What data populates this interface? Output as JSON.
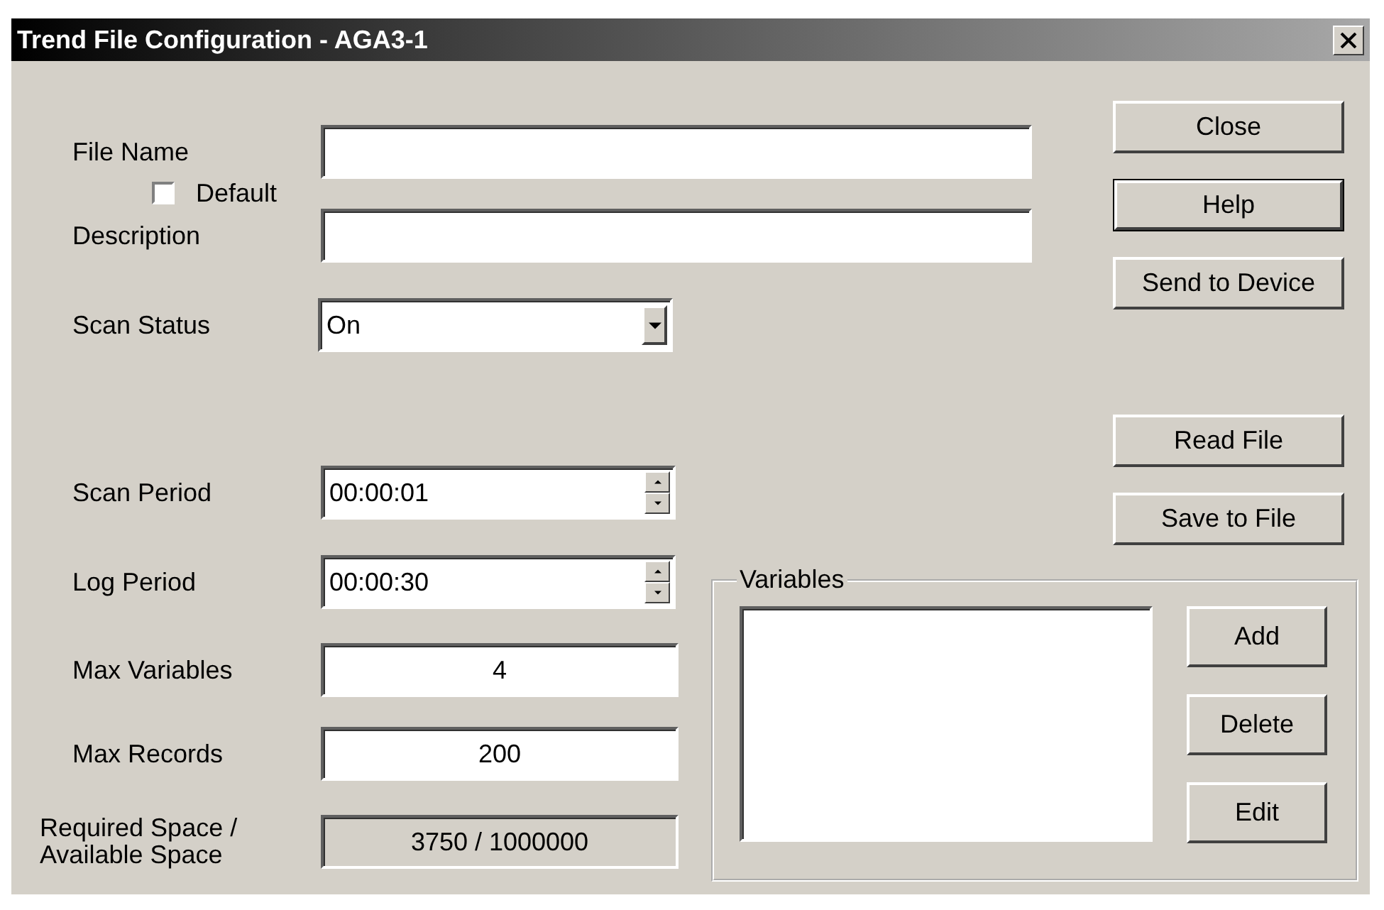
{
  "window": {
    "title": "Trend File Configuration - AGA3-1"
  },
  "fields_upper": [
    {
      "label": "File Name",
      "kind": "text",
      "option": {
        "label": "Default",
        "checked": false
      }
    },
    {
      "label": "Description",
      "kind": "text"
    },
    {
      "label": "Scan Status",
      "kind": "combo",
      "value": "On"
    },
    {
      "label": "Scan Period",
      "kind": "spin",
      "value": "00:00:01"
    }
  ],
  "fields_lower": [
    {
      "label": "Log Period",
      "kind": "spin",
      "value": "00:00:30"
    },
    {
      "label": "Max Variables",
      "kind": "number",
      "value": "4"
    },
    {
      "label": "Max Records",
      "kind": "number",
      "value": "200"
    },
    {
      "label": "Required Space / Available Space",
      "kind": "readout",
      "value": "3750 / 1000000"
    }
  ],
  "buttons_upper": [
    {
      "label": "Close",
      "default": false
    },
    {
      "label": "Help",
      "default": true
    },
    {
      "label": "Send to Device",
      "default": false
    }
  ],
  "buttons_lower": [
    {
      "label": "Read File",
      "default": false
    },
    {
      "label": "Save to File",
      "default": false
    }
  ],
  "variables": {
    "title": "Variables",
    "buttons": [
      "Add",
      "Delete",
      "Edit"
    ]
  }
}
